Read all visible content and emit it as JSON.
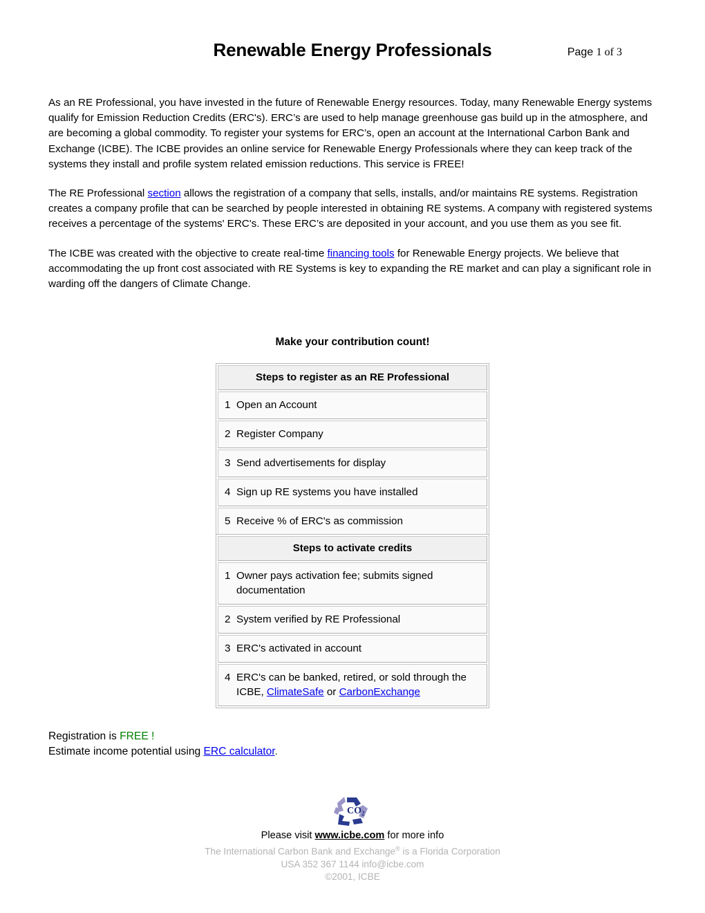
{
  "header": {
    "title": "Renewable Energy Professionals",
    "page_word": "Page",
    "page_count": "1 of  3"
  },
  "paragraphs": {
    "p1": "As an RE Professional, you have invested in the future of Renewable Energy resources. Today, many Renewable Energy systems qualify for Emission Reduction Credits (ERC's). ERC’s are used to help manage greenhouse gas build up in the atmosphere, and are becoming a global commodity. To register your systems for ERC’s, open an account at the International Carbon Bank and Exchange (ICBE). The ICBE provides an online service for Renewable Energy Professionals where they can keep track of the systems they install and profile system related emission reductions. This service is FREE!",
    "p2_before": "The RE Professional ",
    "p2_link": "section",
    "p2_after": " allows the registration of a company that sells, installs, and/or maintains RE systems. Registration creates a company profile that can be searched by people interested in obtaining RE systems. A company with registered systems receives a percentage of the systems' ERC's. These ERC’s are deposited in your account, and you use them as you see fit.",
    "p3_before": "The ICBE was created with the objective to create real-time ",
    "p3_link": "financing tools",
    "p3_after": " for Renewable Energy projects. We believe that accommodating the up front cost associated with RE Systems is key to expanding the RE market and can play a significant role in warding off the dangers of Climate Change."
  },
  "tagline": "Make your contribution count!",
  "table_register": {
    "header": "Steps to register as an RE Professional",
    "rows": [
      {
        "num": "1",
        "text": "Open an Account"
      },
      {
        "num": "2",
        "text": "Register Company"
      },
      {
        "num": "3",
        "text": "Send advertisements for display"
      },
      {
        "num": "4",
        "text": "Sign up RE systems you have installed"
      },
      {
        "num": "5",
        "text": "Receive % of ERC's as commission"
      }
    ]
  },
  "table_activate": {
    "header": "Steps to activate credits",
    "rows": [
      {
        "num": "1",
        "text": "Owner pays activation fee; submits signed documentation"
      },
      {
        "num": "2",
        "text": "System verified by RE Professional"
      },
      {
        "num": "3",
        "text": "ERC's activated in account"
      }
    ],
    "row4": {
      "num": "4",
      "before": "ERC's can be banked, retired, or sold through the ICBE, ",
      "link1": "ClimateSafe",
      "middle": " or ",
      "link2": "CarbonExchange"
    }
  },
  "registration": {
    "line1_before": "Registration is ",
    "line1_free": "FREE !",
    "line2_before": "Estimate income potential using ",
    "line2_link": "ERC calculator",
    "line2_after": "."
  },
  "footer": {
    "logo_text": "CO",
    "logo_sub": "2",
    "visit_before": "Please visit ",
    "visit_url": "www.icbe.com",
    "visit_after": " for more info",
    "corp_before": "The International Carbon Bank and Exchange",
    "corp_sup": "®",
    "corp_after": " is a Florida Corporation",
    "contact": "USA 352 367 1144  info@icbe.com",
    "copyright": "©2001, ICBE"
  },
  "colors": {
    "link": "#0000ee",
    "free_green": "#008000",
    "footer_gray": "#b4b4b4",
    "logo_dark": "#2a3b8f",
    "logo_light": "#9a96c8"
  }
}
